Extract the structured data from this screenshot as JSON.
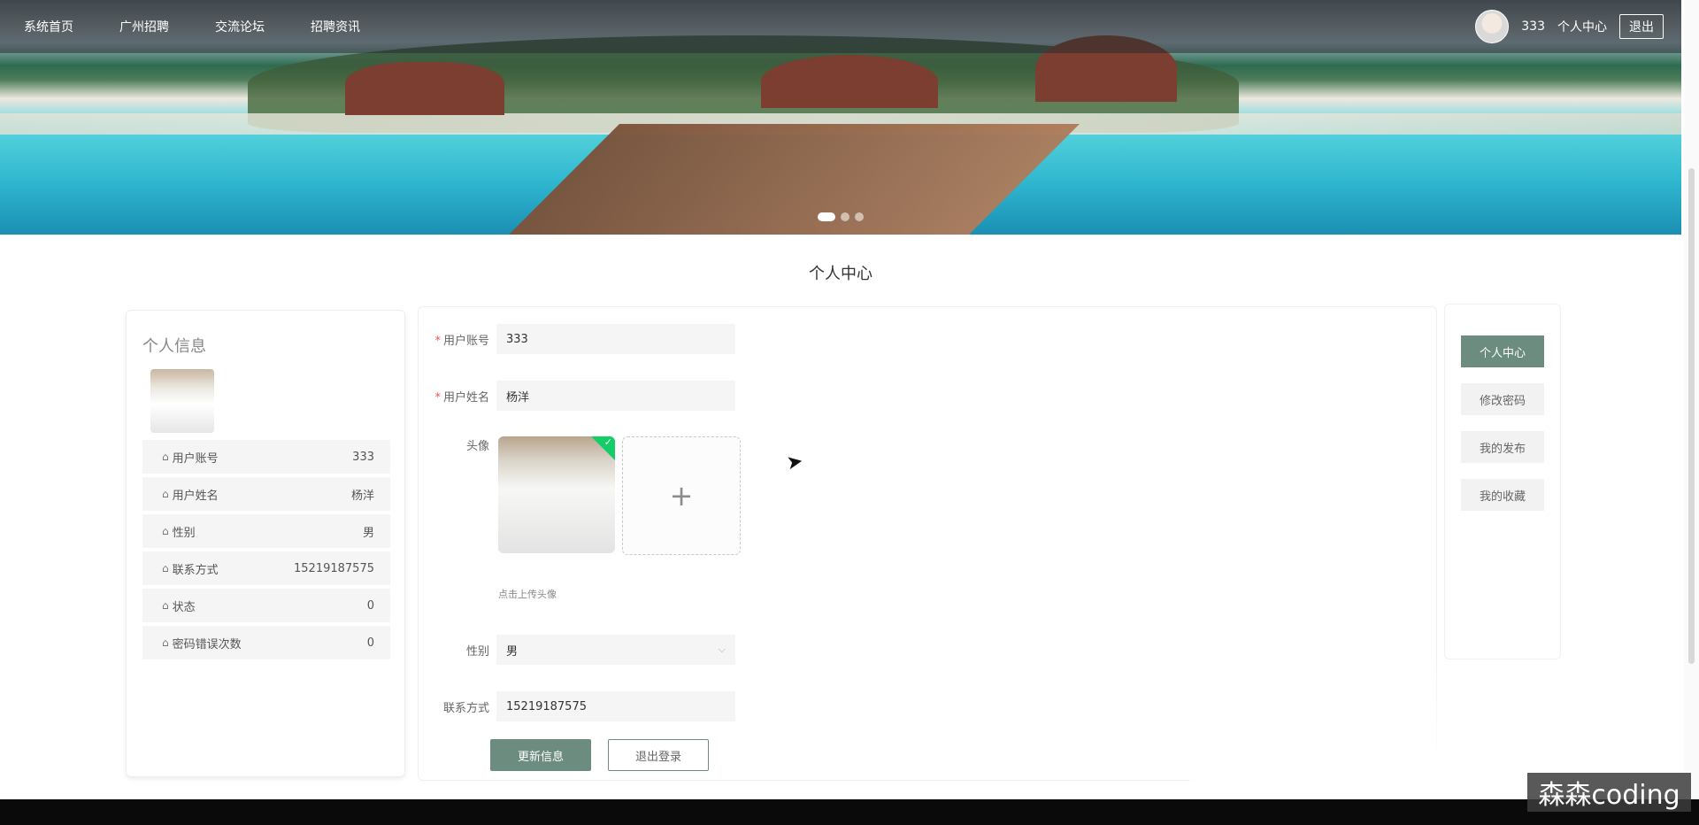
{
  "nav": {
    "items": [
      "系统首页",
      "广州招聘",
      "交流论坛",
      "招聘资讯"
    ],
    "username": "333",
    "center_label": "个人中心",
    "logout_label": "退出"
  },
  "page": {
    "title": "个人中心"
  },
  "profile": {
    "title": "个人信息",
    "rows": [
      {
        "label": "用户账号",
        "value": "333"
      },
      {
        "label": "用户姓名",
        "value": "杨洋"
      },
      {
        "label": "性别",
        "value": "男"
      },
      {
        "label": "联系方式",
        "value": "15219187575"
      },
      {
        "label": "状态",
        "value": "0"
      },
      {
        "label": "密码错误次数",
        "value": "0"
      }
    ]
  },
  "form": {
    "account_label": "用户账号",
    "account_value": "333",
    "name_label": "用户姓名",
    "name_value": "杨洋",
    "avatar_label": "头像",
    "upload_tip": "点击上传头像",
    "gender_label": "性别",
    "gender_value": "男",
    "phone_label": "联系方式",
    "phone_value": "15219187575",
    "update_label": "更新信息",
    "logout_label": "退出登录"
  },
  "side_menu": [
    "个人中心",
    "修改密码",
    "我的发布",
    "我的收藏"
  ],
  "carousel": {
    "slide_count": 3,
    "active": 1
  },
  "watermark": "森森coding",
  "icons": {
    "home": "home-icon",
    "plus": "plus-icon",
    "chevron": "chevron-down-icon",
    "check": "check-icon"
  },
  "colors": {
    "primary": "#6c8c80",
    "required": "#e05a5a",
    "success": "#13ce66"
  }
}
